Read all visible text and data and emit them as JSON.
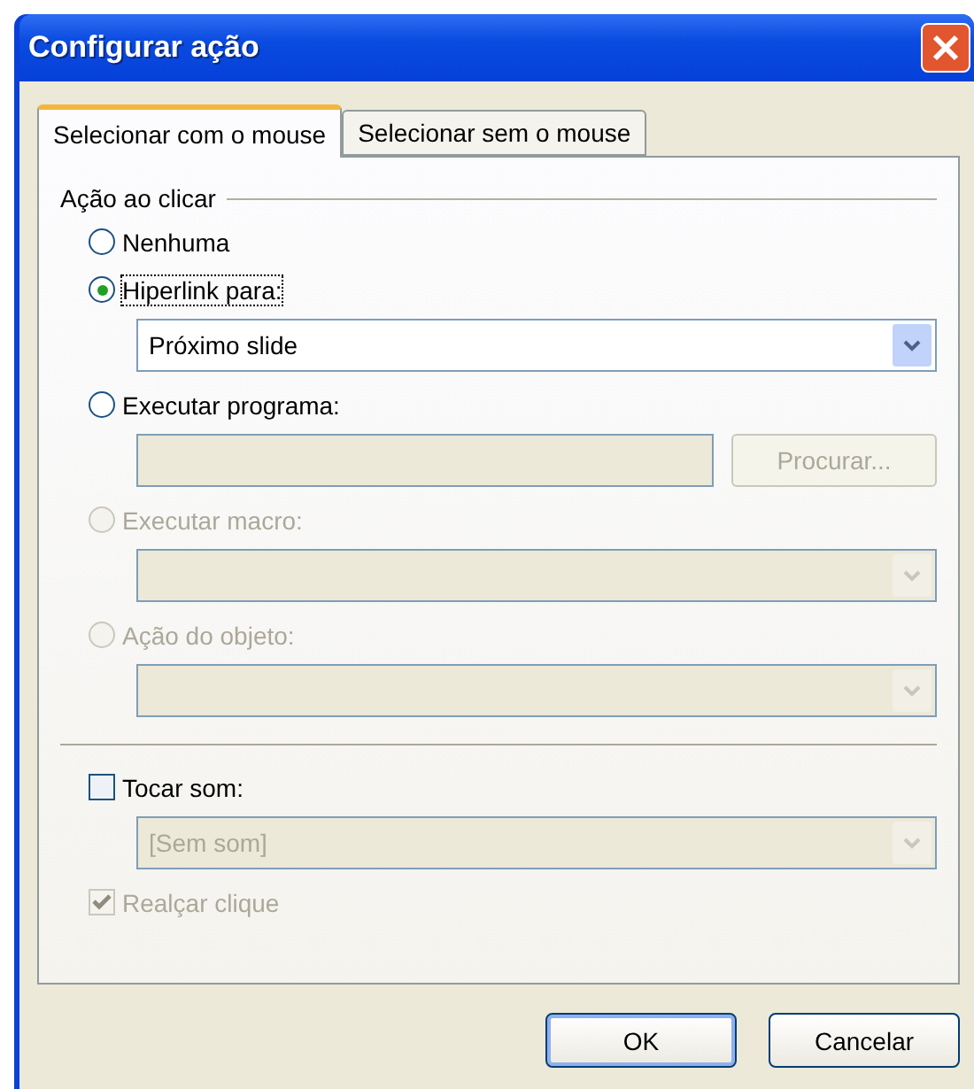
{
  "window": {
    "title": "Configurar ação"
  },
  "tabs": [
    {
      "label": "Selecionar com o mouse",
      "selected": true
    },
    {
      "label": "Selecionar sem o mouse",
      "selected": false
    }
  ],
  "group": {
    "title": "Ação ao clicar"
  },
  "actions": [
    {
      "label": "Nenhuma",
      "selected": false,
      "disabled": false,
      "focused": false
    },
    {
      "label": "Hiperlink para:",
      "selected": true,
      "disabled": false,
      "focused": true,
      "control": {
        "kind": "dropdown",
        "value": "Próximo slide",
        "disabled": false
      }
    },
    {
      "label": "Executar programa:",
      "selected": false,
      "disabled": false,
      "focused": false,
      "control": {
        "kind": "textbox",
        "disabled": true,
        "button": {
          "label": "Procurar...",
          "disabled": true
        }
      }
    },
    {
      "label": "Executar macro:",
      "selected": false,
      "disabled": true,
      "focused": false,
      "control": {
        "kind": "dropdown",
        "disabled": true
      }
    },
    {
      "label": "Ação do objeto:",
      "selected": false,
      "disabled": true,
      "focused": false,
      "control": {
        "kind": "dropdown",
        "disabled": true
      }
    }
  ],
  "sound": {
    "label": "Tocar som:",
    "checked": false,
    "disabled": false
  },
  "sound_select": {
    "value": "[Sem som]",
    "disabled": true
  },
  "highlight": {
    "label": "Realçar clique",
    "checked": true,
    "disabled": true
  },
  "buttons": [
    {
      "label": "OK",
      "default": true
    },
    {
      "label": "Cancelar",
      "default": false
    }
  ]
}
